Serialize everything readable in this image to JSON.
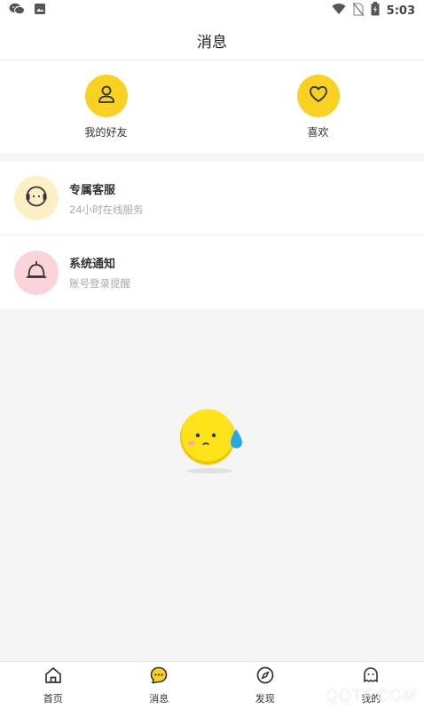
{
  "status_bar": {
    "time": "5:03",
    "icons": [
      "wechat-icon",
      "image-icon",
      "wifi-icon",
      "no-sim-icon",
      "battery-icon"
    ]
  },
  "header": {
    "title": "消息"
  },
  "quick_actions": [
    {
      "label": "我的好友",
      "icon": "user-icon"
    },
    {
      "label": "喜欢",
      "icon": "heart-icon"
    }
  ],
  "messages": [
    {
      "title": "专属客服",
      "subtitle": "24小时在线服务",
      "icon": "headset-icon",
      "icon_bg": "#fdf0c6"
    },
    {
      "title": "系统通知",
      "subtitle": "账号登录提醒",
      "icon": "bell-icon",
      "icon_bg": "#fbd3da"
    }
  ],
  "bottom_nav": [
    {
      "label": "首页",
      "icon": "home-icon"
    },
    {
      "label": "消息",
      "icon": "chat-icon"
    },
    {
      "label": "发现",
      "icon": "compass-icon"
    },
    {
      "label": "我的",
      "icon": "ghost-icon"
    }
  ],
  "watermark": "QQTF.COM",
  "colors": {
    "accent": "#f8d123",
    "background": "#f5f5f5"
  }
}
